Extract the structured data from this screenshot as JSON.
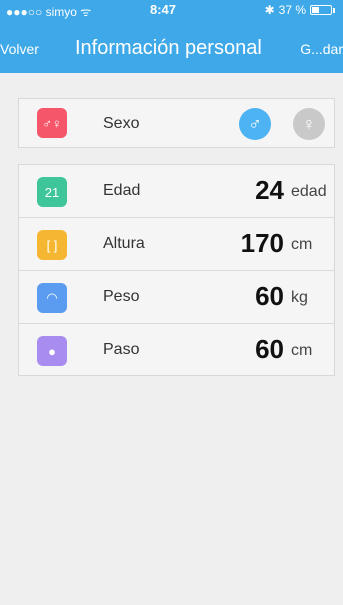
{
  "status": {
    "carrier": "●●●○○ simyo ᯤ",
    "time": "8:47",
    "bluetooth": "✱",
    "battery": "37 %",
    "battery_level": 0.37
  },
  "nav": {
    "back": "Volver",
    "title": "Información personal",
    "save": "G...dar"
  },
  "sex": {
    "icon": "gender-symbol-icon",
    "icon_glyph": "♂♀",
    "label": "Sexo",
    "male_glyph": "♂",
    "female_glyph": "♀",
    "selected": "male"
  },
  "rows": [
    {
      "label": "Edad",
      "value": "24",
      "unit": "edad",
      "icon": "calendar-icon",
      "icon_glyph": "21",
      "color": "#3ec59a"
    },
    {
      "label": "Altura",
      "value": "170",
      "unit": "cm",
      "icon": "ruler-icon",
      "icon_glyph": "[ ]",
      "color": "#f5b731"
    },
    {
      "label": "Peso",
      "value": "60",
      "unit": "kg",
      "icon": "gauge-icon",
      "icon_glyph": "◠",
      "color": "#5b9cf0"
    },
    {
      "label": "Paso",
      "value": "60",
      "unit": "cm",
      "icon": "location-pin-icon",
      "icon_glyph": "●",
      "color": "#a98cf0"
    }
  ],
  "colors": {
    "accent": "#3ea8e8",
    "sex_icon": "#f5566a",
    "male_selected": "#4db3f2",
    "female_unselected": "#c9c9c9"
  }
}
